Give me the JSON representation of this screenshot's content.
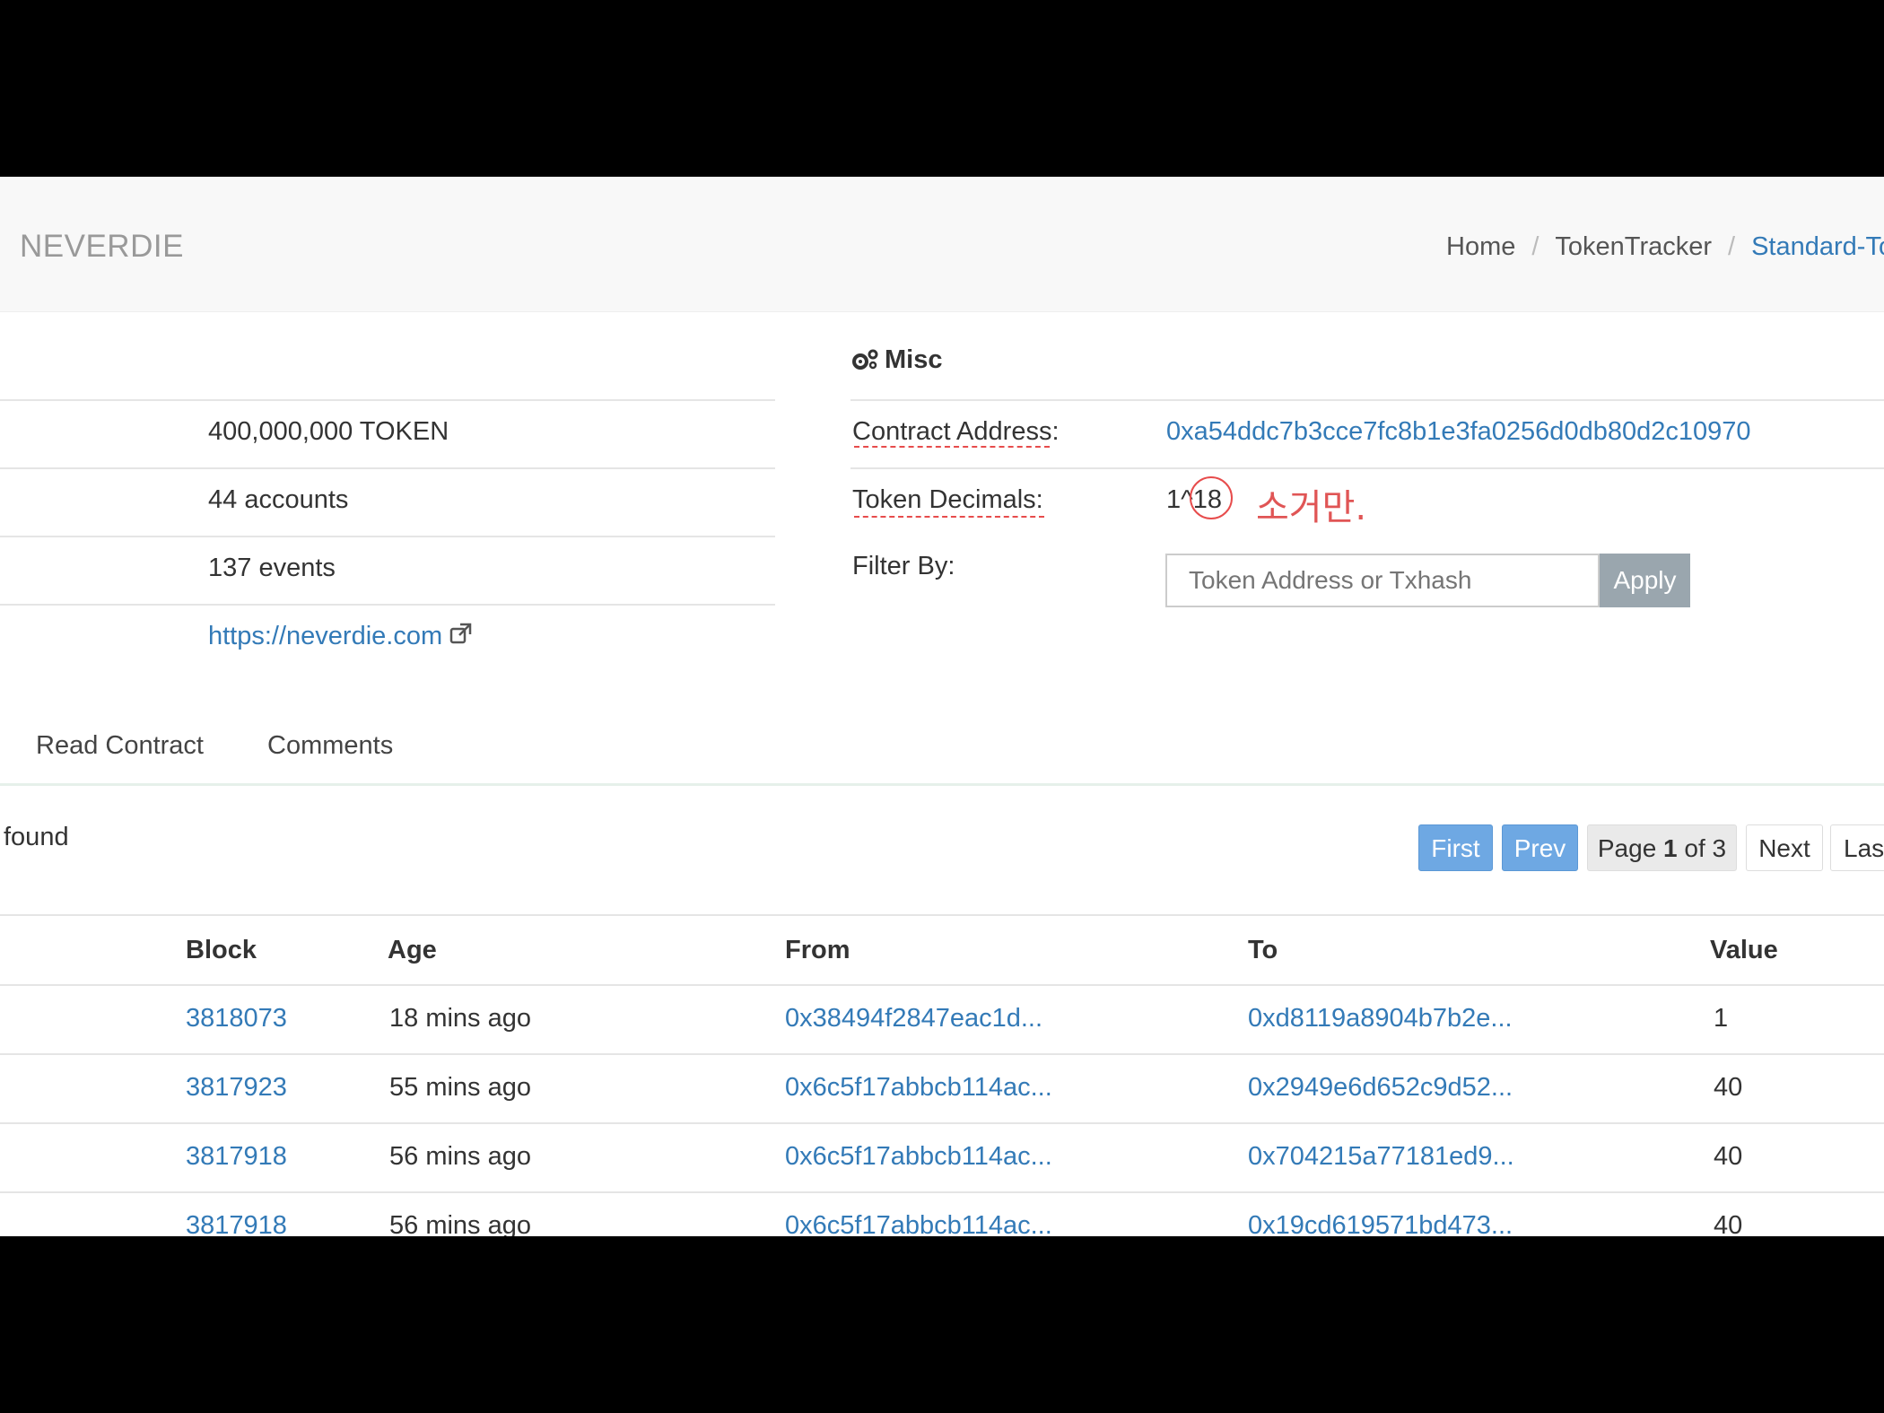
{
  "header": {
    "brand": "NEVERDIE",
    "breadcrumb": [
      "Home",
      "TokenTracker",
      "Standard-To"
    ]
  },
  "summary": {
    "total_supply": "400,000,000 TOKEN",
    "holders": "44 accounts",
    "transfers": "137 events",
    "website": "https://neverdie.com"
  },
  "misc": {
    "title": "Misc",
    "contract_label": "Contract Address:",
    "contract_value": "0xa54ddc7b3cce7fc8b1e3fa0256d0db80d2c10970",
    "decimals_label": "Token Decimals:",
    "decimals_prefix": "1^",
    "decimals_value": "18",
    "handwritten_note": "소거만.",
    "filter_label": "Filter By:",
    "filter_placeholder": "Token Address or Txhash",
    "apply_label": "Apply"
  },
  "tabs": [
    "Read Contract",
    "Comments"
  ],
  "results_text": "found",
  "pager": {
    "first": "First",
    "prev": "Prev",
    "page_prefix": "Page ",
    "page_current": "1",
    "page_suffix": " of 3",
    "next": "Next",
    "last": "Las"
  },
  "table": {
    "columns": [
      "Block",
      "Age",
      "From",
      "To",
      "Value"
    ],
    "rows": [
      {
        "block": "3818073",
        "age": "18 mins ago",
        "from": "0x38494f2847eac1d...",
        "to": "0xd8119a8904b7b2e...",
        "value": "1"
      },
      {
        "block": "3817923",
        "age": "55 mins ago",
        "from": "0x6c5f17abbcb114ac...",
        "to": "0x2949e6d652c9d52...",
        "value": "40"
      },
      {
        "block": "3817918",
        "age": "56 mins ago",
        "from": "0x6c5f17abbcb114ac...",
        "to": "0x704215a77181ed9...",
        "value": "40"
      },
      {
        "block": "3817918",
        "age": "56 mins ago",
        "from": "0x6c5f17abbcb114ac...",
        "to": "0x19cd619571bd473...",
        "value": "40"
      }
    ]
  },
  "colors": {
    "link": "#337ab7",
    "pager_blue": "#6ea8e3",
    "annotation_red": "#e74c4c",
    "letterbox": "#000000"
  }
}
